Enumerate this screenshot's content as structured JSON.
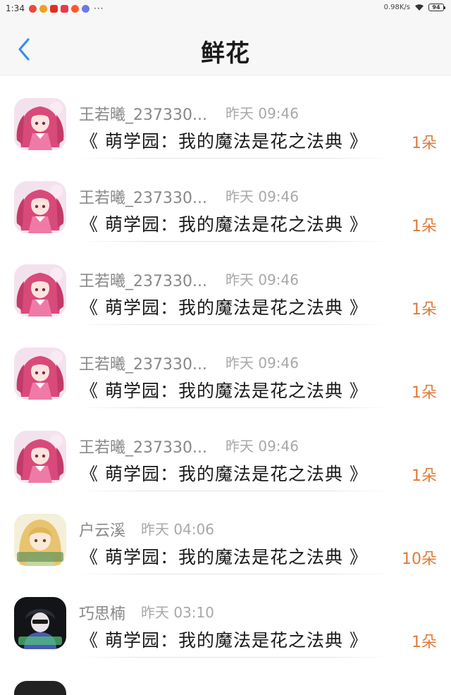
{
  "status_bar": {
    "time": "1:34",
    "more": "···",
    "net_speed": "0.98K/s",
    "battery": "94",
    "notification_colors": [
      "#e84a3c",
      "#f0a020",
      "#e03020",
      "#e83a4a",
      "#ff5a2a",
      "#6a7ae8"
    ]
  },
  "header": {
    "back_icon": "chevron-left-icon",
    "title": "鲜花",
    "accent": "#3a8ee6"
  },
  "items": [
    {
      "name": "王若曦_237330...",
      "time": "昨天 09:46",
      "title": "《 萌学园：我的魔法是花之法典 》",
      "count": "1朵",
      "avatar": "anime-pink-girl"
    },
    {
      "name": "王若曦_237330...",
      "time": "昨天 09:46",
      "title": "《 萌学园：我的魔法是花之法典 》",
      "count": "1朵",
      "avatar": "anime-pink-girl"
    },
    {
      "name": "王若曦_237330...",
      "time": "昨天 09:46",
      "title": "《 萌学园：我的魔法是花之法典 》",
      "count": "1朵",
      "avatar": "anime-pink-girl"
    },
    {
      "name": "王若曦_237330...",
      "time": "昨天 09:46",
      "title": "《 萌学园：我的魔法是花之法典 》",
      "count": "1朵",
      "avatar": "anime-pink-girl"
    },
    {
      "name": "王若曦_237330...",
      "time": "昨天 09:46",
      "title": "《 萌学园：我的魔法是花之法典 》",
      "count": "1朵",
      "avatar": "anime-pink-girl"
    },
    {
      "name": "户云溪",
      "time": "昨天 04:06",
      "title": "《 萌学园：我的魔法是花之法典 》",
      "count": "10朵",
      "avatar": "anime-blonde-girl"
    },
    {
      "name": "巧思楠",
      "time": "昨天 03:10",
      "title": "《 萌学园：我的魔法是花之法典 》",
      "count": "1朵",
      "avatar": "anime-dark-boy"
    }
  ],
  "colors": {
    "count": "#e07a38",
    "name": "#888888",
    "time": "#a8a8a8"
  }
}
